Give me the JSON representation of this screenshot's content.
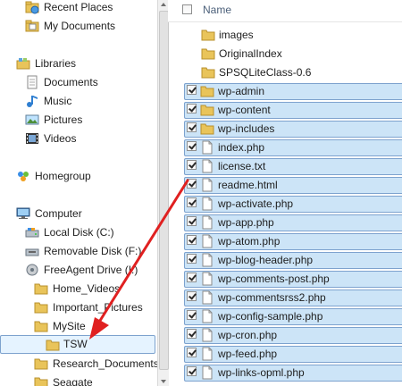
{
  "nav": {
    "recent_places": "Recent Places",
    "my_documents": "My Documents",
    "libraries": "Libraries",
    "documents": "Documents",
    "music": "Music",
    "pictures": "Pictures",
    "videos": "Videos",
    "homegroup": "Homegroup",
    "computer": "Computer",
    "local_disk": "Local Disk (C:)",
    "removable_disk": "Removable Disk (F:)",
    "freeagent": "FreeAgent Drive (I:)",
    "home_videos": "Home_Videos",
    "important_pictures": "Important_Pictures",
    "mysite": "MySite",
    "tsw": "TSW",
    "research_documents": "Research_Documents",
    "seagate": "Seagate"
  },
  "content": {
    "header_name": "Name",
    "files": [
      {
        "name": "images",
        "type": "folder",
        "selected": false
      },
      {
        "name": "OriginalIndex",
        "type": "folder",
        "selected": false
      },
      {
        "name": "SPSQLiteClass-0.6",
        "type": "folder",
        "selected": false
      },
      {
        "name": "wp-admin",
        "type": "folder",
        "selected": true
      },
      {
        "name": "wp-content",
        "type": "folder",
        "selected": true
      },
      {
        "name": "wp-includes",
        "type": "folder",
        "selected": true
      },
      {
        "name": "index.php",
        "type": "file",
        "selected": true
      },
      {
        "name": "license.txt",
        "type": "file",
        "selected": true
      },
      {
        "name": "readme.html",
        "type": "file",
        "selected": true
      },
      {
        "name": "wp-activate.php",
        "type": "file",
        "selected": true
      },
      {
        "name": "wp-app.php",
        "type": "file",
        "selected": true
      },
      {
        "name": "wp-atom.php",
        "type": "file",
        "selected": true
      },
      {
        "name": "wp-blog-header.php",
        "type": "file",
        "selected": true
      },
      {
        "name": "wp-comments-post.php",
        "type": "file",
        "selected": true
      },
      {
        "name": "wp-commentsrss2.php",
        "type": "file",
        "selected": true
      },
      {
        "name": "wp-config-sample.php",
        "type": "file",
        "selected": true
      },
      {
        "name": "wp-cron.php",
        "type": "file",
        "selected": true
      },
      {
        "name": "wp-feed.php",
        "type": "file",
        "selected": true
      },
      {
        "name": "wp-links-opml.php",
        "type": "file",
        "selected": true
      }
    ]
  },
  "colors": {
    "selection_bg": "#cce4f7",
    "selection_border": "#7da2ce",
    "folder": "#e9c45a",
    "arrow": "#e02020"
  }
}
